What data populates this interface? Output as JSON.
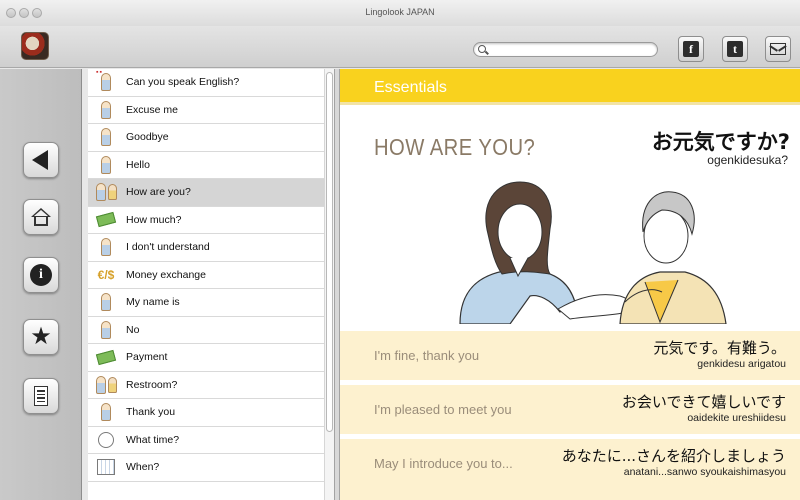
{
  "window": {
    "title": "Lingolook JAPAN"
  },
  "toolbar": {
    "search_placeholder": "",
    "facebook_label": "f",
    "twitter_label": "t"
  },
  "nav": {
    "back_icon": "back-arrow-icon",
    "home_icon": "home-icon",
    "info_label": "i",
    "favorites_icon": "star-icon",
    "list_icon": "notes-icon"
  },
  "phrases": [
    {
      "label": "Can you speak English?",
      "icon": "flags-person"
    },
    {
      "label": "Excuse me",
      "icon": "person"
    },
    {
      "label": "Goodbye",
      "icon": "person"
    },
    {
      "label": "Hello",
      "icon": "person"
    },
    {
      "label": "How are you?",
      "icon": "two-people",
      "selected": true
    },
    {
      "label": "How much?",
      "icon": "money"
    },
    {
      "label": "I don't understand",
      "icon": "person"
    },
    {
      "label": "Money exchange",
      "icon": "currency"
    },
    {
      "label": "My name is",
      "icon": "person"
    },
    {
      "label": "No",
      "icon": "person"
    },
    {
      "label": "Payment",
      "icon": "money"
    },
    {
      "label": "Restroom?",
      "icon": "two-people"
    },
    {
      "label": "Thank you",
      "icon": "person"
    },
    {
      "label": "What time?",
      "icon": "clock"
    },
    {
      "label": "When?",
      "icon": "calendar"
    }
  ],
  "content": {
    "category": "Essentials",
    "english": "HOW ARE YOU?",
    "japanese": "お元気ですか?",
    "romaji": "ogenkidesuka?",
    "responses": [
      {
        "english": "I'm fine, thank you",
        "japanese": "元気です。有難う。",
        "romaji": "genkidesu arigatou"
      },
      {
        "english": "I'm pleased to meet you",
        "japanese": "お会いできて嬉しいです",
        "romaji": "oaidekite ureshiidesu"
      },
      {
        "english": "May I introduce you to...",
        "japanese": "あなたに...さんを紹介しましょう",
        "romaji": "anatani...sanwo syoukaishimasyou"
      }
    ]
  },
  "colors": {
    "accent_yellow": "#f9d21e",
    "response_bg": "#fdf1cf",
    "selected_row": "#d5d5d5"
  }
}
